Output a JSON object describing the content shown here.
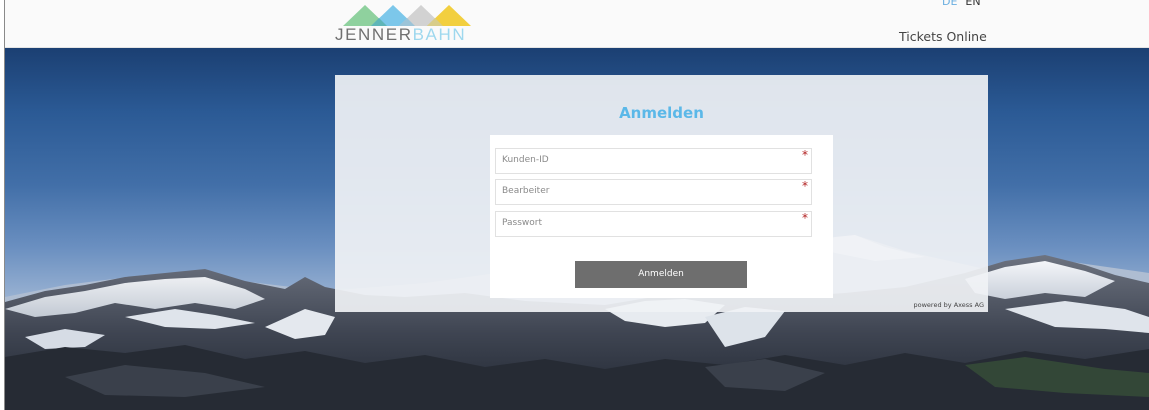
{
  "header": {
    "logo_text_a": "JENNER",
    "logo_text_b": "BAHN",
    "lang_de": "DE",
    "lang_en": "EN",
    "tickets_label": "Tickets Online"
  },
  "login": {
    "title": "Anmelden",
    "fields": [
      {
        "placeholder": "Kunden-ID",
        "required_mark": "*"
      },
      {
        "placeholder": "Bearbeiter",
        "required_mark": "*"
      },
      {
        "placeholder": "Passwort",
        "required_mark": "*"
      }
    ],
    "submit_label": "Anmelden",
    "powered_by": "powered by Axess AG"
  },
  "colors": {
    "accent": "#5bb8e8",
    "button": "#6e6e6e",
    "required": "#b22222",
    "logo_tri_1": "#8fd19e",
    "logo_tri_2": "#7cc7ea",
    "logo_tri_3": "#c8c8c8",
    "logo_tri_4": "#f2cf3f"
  }
}
